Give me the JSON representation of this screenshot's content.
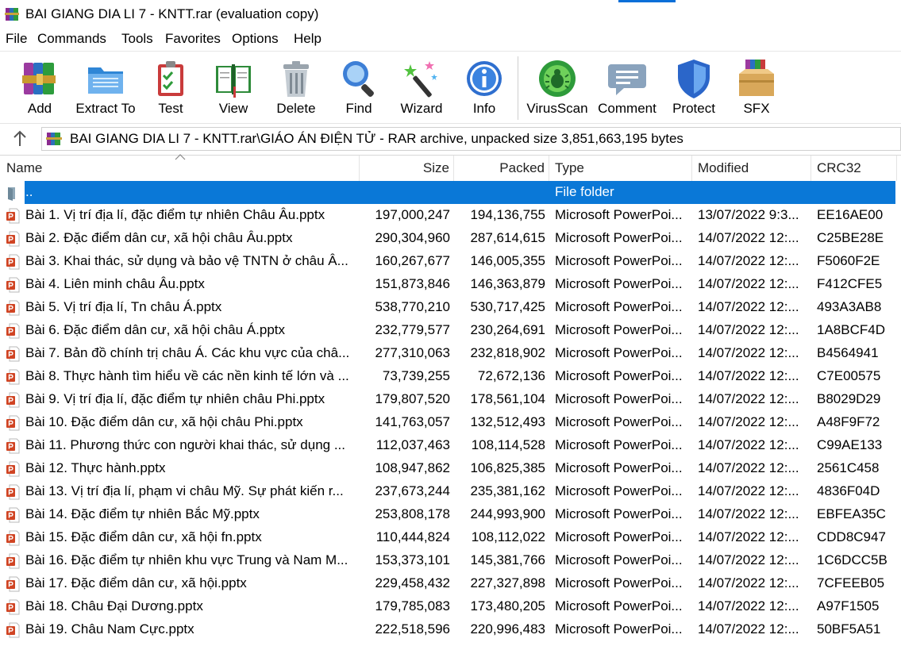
{
  "window": {
    "title": "BAI GIANG DIA LI 7 - KNTT.rar (evaluation copy)",
    "app_icon": "winrar-books-icon"
  },
  "menu": [
    "File",
    "Commands",
    "Tools",
    "Favorites",
    "Options",
    "Help"
  ],
  "toolbar": [
    {
      "label": "Add",
      "icon": "add-archive-icon"
    },
    {
      "label": "Extract To",
      "icon": "extract-folder-icon"
    },
    {
      "label": "Test",
      "icon": "test-clipboard-icon"
    },
    {
      "label": "View",
      "icon": "view-book-icon"
    },
    {
      "label": "Delete",
      "icon": "delete-trash-icon"
    },
    {
      "label": "Find",
      "icon": "find-magnifier-icon"
    },
    {
      "label": "Wizard",
      "icon": "wizard-wand-icon"
    },
    {
      "label": "Info",
      "icon": "info-icon"
    },
    {
      "label": "VirusScan",
      "icon": "virusscan-bug-icon"
    },
    {
      "label": "Comment",
      "icon": "comment-bubble-icon"
    },
    {
      "label": "Protect",
      "icon": "protect-shield-icon"
    },
    {
      "label": "SFX",
      "icon": "sfx-box-icon"
    }
  ],
  "path": {
    "text": "BAI GIANG DIA LI 7 - KNTT.rar\\GIÁO ÁN ĐIỆN TỬ - RAR archive, unpacked size 3,851,663,195 bytes"
  },
  "columns": {
    "name": "Name",
    "size": "Size",
    "packed": "Packed",
    "type": "Type",
    "modified": "Modified",
    "crc": "CRC32"
  },
  "parent_row": {
    "name": "..",
    "type": "File folder"
  },
  "files": [
    {
      "name": "Bài 1. Vị trí địa lí, đặc điểm tự nhiên Châu Âu.pptx",
      "size": "197,000,247",
      "packed": "194,136,755",
      "type": "Microsoft PowerPoi...",
      "modified": "13/07/2022 9:3...",
      "crc": "EE16AE00"
    },
    {
      "name": "Bài 2. Đặc điểm dân cư, xã hội châu Âu.pptx",
      "size": "290,304,960",
      "packed": "287,614,615",
      "type": "Microsoft PowerPoi...",
      "modified": "14/07/2022 12:...",
      "crc": "C25BE28E"
    },
    {
      "name": "Bài 3. Khai thác, sử dụng và bảo vệ TNTN ở châu Â...",
      "size": "160,267,677",
      "packed": "146,005,355",
      "type": "Microsoft PowerPoi...",
      "modified": "14/07/2022 12:...",
      "crc": "F5060F2E"
    },
    {
      "name": "Bài 4. Liên minh châu Âu.pptx",
      "size": "151,873,846",
      "packed": "146,363,879",
      "type": "Microsoft PowerPoi...",
      "modified": "14/07/2022 12:...",
      "crc": "F412CFE5"
    },
    {
      "name": "Bài 5. Vị trí địa lí, Tn châu Á.pptx",
      "size": "538,770,210",
      "packed": "530,717,425",
      "type": "Microsoft PowerPoi...",
      "modified": "14/07/2022 12:...",
      "crc": "493A3AB8"
    },
    {
      "name": "Bài 6. Đặc điểm dân cư, xã hội châu Á.pptx",
      "size": "232,779,577",
      "packed": "230,264,691",
      "type": "Microsoft PowerPoi...",
      "modified": "14/07/2022 12:...",
      "crc": "1A8BCF4D"
    },
    {
      "name": "Bài 7. Bản đồ chính trị châu Á. Các khu vực của châ...",
      "size": "277,310,063",
      "packed": "232,818,902",
      "type": "Microsoft PowerPoi...",
      "modified": "14/07/2022 12:...",
      "crc": "B4564941"
    },
    {
      "name": "Bài 8. Thực hành tìm hiểu về các nền kinh tế lớn và ...",
      "size": "73,739,255",
      "packed": "72,672,136",
      "type": "Microsoft PowerPoi...",
      "modified": "14/07/2022 12:...",
      "crc": "C7E00575"
    },
    {
      "name": "Bài 9. Vị trí địa lí, đặc điểm tự nhiên châu Phi.pptx",
      "size": "179,807,520",
      "packed": "178,561,104",
      "type": "Microsoft PowerPoi...",
      "modified": "14/07/2022 12:...",
      "crc": "B8029D29"
    },
    {
      "name": "Bài 10. Đặc điểm dân cư, xã hội châu Phi.pptx",
      "size": "141,763,057",
      "packed": "132,512,493",
      "type": "Microsoft PowerPoi...",
      "modified": "14/07/2022 12:...",
      "crc": "A48F9F72"
    },
    {
      "name": "Bài 11. Phương thức con người khai thác, sử dụng ...",
      "size": "112,037,463",
      "packed": "108,114,528",
      "type": "Microsoft PowerPoi...",
      "modified": "14/07/2022 12:...",
      "crc": "C99AE133"
    },
    {
      "name": "Bài 12. Thực hành.pptx",
      "size": "108,947,862",
      "packed": "106,825,385",
      "type": "Microsoft PowerPoi...",
      "modified": "14/07/2022 12:...",
      "crc": "2561C458"
    },
    {
      "name": "Bài 13. Vị trí địa lí, phạm vi châu Mỹ. Sự phát kiến r...",
      "size": "237,673,244",
      "packed": "235,381,162",
      "type": "Microsoft PowerPoi...",
      "modified": "14/07/2022 12:...",
      "crc": "4836F04D"
    },
    {
      "name": "Bài 14. Đặc điểm tự nhiên Bắc Mỹ.pptx",
      "size": "253,808,178",
      "packed": "244,993,900",
      "type": "Microsoft PowerPoi...",
      "modified": "14/07/2022 12:...",
      "crc": "EBFEA35C"
    },
    {
      "name": "Bài 15. Đặc điểm dân cư, xã hội fn.pptx",
      "size": "110,444,824",
      "packed": "108,112,022",
      "type": "Microsoft PowerPoi...",
      "modified": "14/07/2022 12:...",
      "crc": "CDD8C947"
    },
    {
      "name": "Bài 16. Đặc điểm tự nhiên khu vực Trung và Nam M...",
      "size": "153,373,101",
      "packed": "145,381,766",
      "type": "Microsoft PowerPoi...",
      "modified": "14/07/2022 12:...",
      "crc": "1C6DCC5B"
    },
    {
      "name": "Bài 17. Đặc điểm dân cư, xã hội.pptx",
      "size": "229,458,432",
      "packed": "227,327,898",
      "type": "Microsoft PowerPoi...",
      "modified": "14/07/2022 12:...",
      "crc": "7CFEEB05"
    },
    {
      "name": "Bài 18. Châu Đại Dương.pptx",
      "size": "179,785,083",
      "packed": "173,480,205",
      "type": "Microsoft PowerPoi...",
      "modified": "14/07/2022 12:...",
      "crc": "A97F1505"
    },
    {
      "name": "Bài 19. Châu Nam Cực.pptx",
      "size": "222,518,596",
      "packed": "220,996,483",
      "type": "Microsoft PowerPoi...",
      "modified": "14/07/2022 12:...",
      "crc": "50BF5A51"
    }
  ],
  "colors": {
    "selection": "#0a78d7",
    "pptx_icon": "#d04423"
  }
}
